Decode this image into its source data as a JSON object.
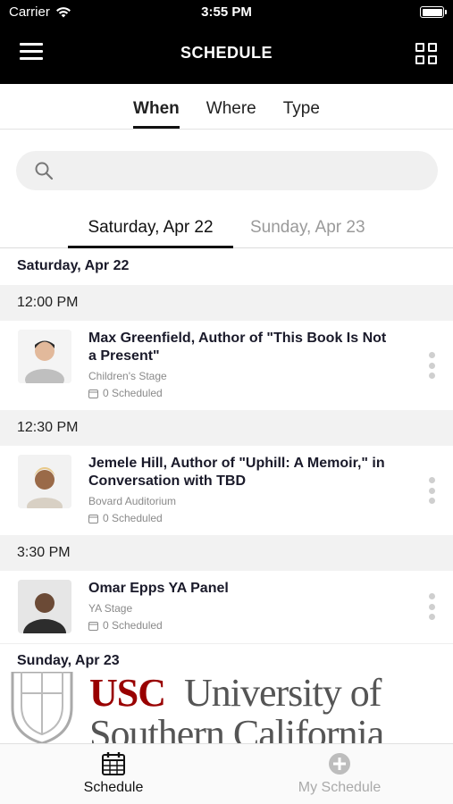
{
  "status_bar": {
    "carrier": "Carrier",
    "time": "3:55 PM"
  },
  "nav": {
    "title": "SCHEDULE",
    "menu_icon": "hamburger-menu-icon",
    "grid_icon": "grid-view-icon"
  },
  "filter_tabs": [
    {
      "label": "When",
      "active": true
    },
    {
      "label": "Where",
      "active": false
    },
    {
      "label": "Type",
      "active": false
    }
  ],
  "search": {
    "placeholder": ""
  },
  "day_tabs": [
    {
      "label": "Saturday, Apr 22",
      "active": true
    },
    {
      "label": "Sunday, Apr 23",
      "active": false
    }
  ],
  "schedule": {
    "day1_header": "Saturday, Apr 22",
    "groups": [
      {
        "time": "12:00 PM",
        "event": {
          "title": "Max Greenfield, Author of \"This Book Is Not a Present\"",
          "venue": "Children's Stage",
          "scheduled": "0 Scheduled"
        }
      },
      {
        "time": "12:30 PM",
        "event": {
          "title": "Jemele Hill, Author of \"Uphill: A Memoir,\" in Conversation with TBD",
          "venue": "Bovard Auditorium",
          "scheduled": "0 Scheduled"
        }
      },
      {
        "time": "3:30 PM",
        "event": {
          "title": "Omar Epps YA Panel",
          "venue": "YA Stage",
          "scheduled": "0 Scheduled"
        }
      }
    ],
    "day2_header": "Sunday, Apr 23"
  },
  "sponsor": {
    "usc": "USC",
    "line1": "University of",
    "line2": "Southern California"
  },
  "tab_bar": [
    {
      "label": "Schedule",
      "icon": "calendar-icon",
      "active": true
    },
    {
      "label": "My Schedule",
      "icon": "plus-circle-icon",
      "active": false
    }
  ],
  "colors": {
    "nav_bg": "#000000",
    "usc_red": "#990000",
    "inactive": "#9a9a9a"
  }
}
